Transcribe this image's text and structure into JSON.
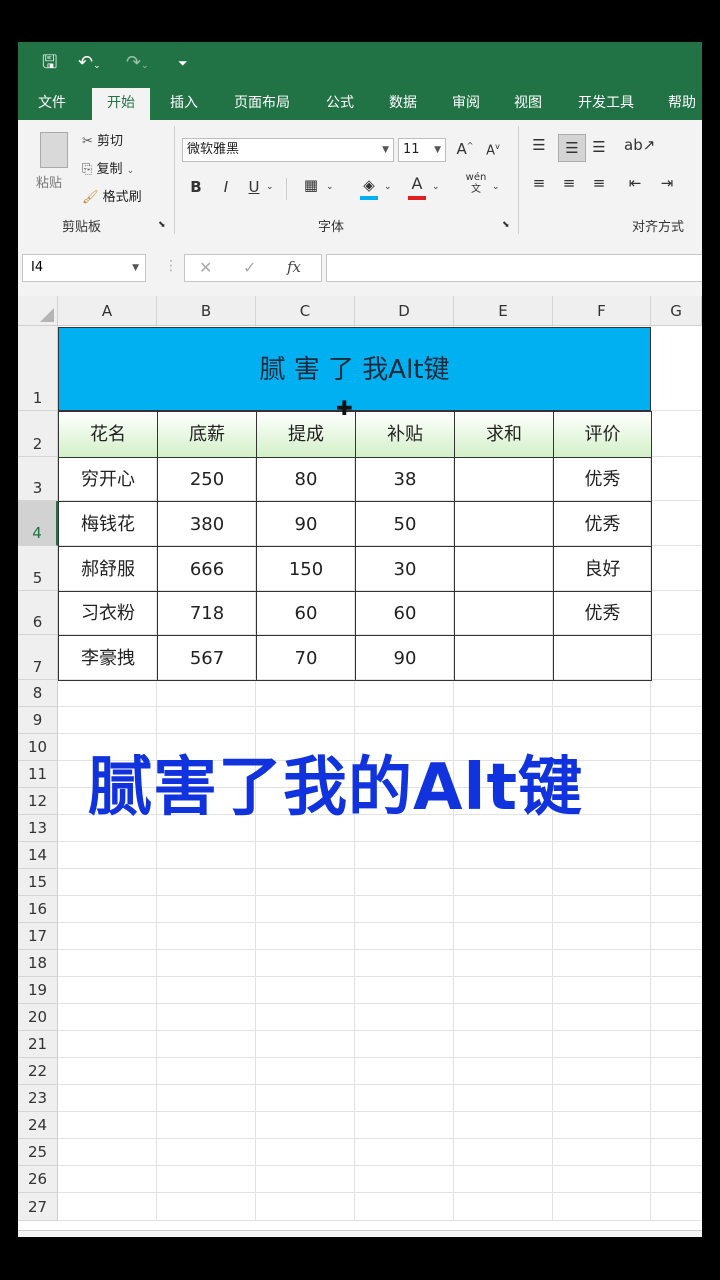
{
  "quick_access": {
    "save_icon": "save-icon",
    "undo_icon": "undo-icon",
    "redo_icon": "redo-icon",
    "customize_icon": "customize-icon"
  },
  "tabs": [
    "文件",
    "开始",
    "插入",
    "页面布局",
    "公式",
    "数据",
    "审阅",
    "视图",
    "开发工具",
    "帮助"
  ],
  "active_tab": "开始",
  "ribbon": {
    "clipboard": {
      "paste": "粘贴",
      "cut": "剪切",
      "copy": "复制",
      "format_painter": "格式刷",
      "group_label": "剪贴板"
    },
    "font": {
      "font_name": "微软雅黑",
      "font_size": "11",
      "bold": "B",
      "italic": "I",
      "underline": "U",
      "phonetic": "wén",
      "group_label": "字体"
    },
    "alignment": {
      "group_label": "对齐方式"
    }
  },
  "formula_bar": {
    "name_box": "I4",
    "cancel": "✕",
    "enter": "✓",
    "fx": "fx",
    "value": ""
  },
  "columns": [
    "A",
    "B",
    "C",
    "D",
    "E",
    "F",
    "G"
  ],
  "rows": [
    "1",
    "2",
    "3",
    "4",
    "5",
    "6",
    "7",
    "8",
    "9",
    "10",
    "11",
    "12",
    "13",
    "14",
    "15",
    "16",
    "17",
    "18",
    "19",
    "20",
    "21",
    "22",
    "23",
    "24",
    "25",
    "26",
    "27"
  ],
  "sheet": {
    "title": "腻 害 了 我Alt键",
    "headers": [
      "花名",
      "底薪",
      "提成",
      "补贴",
      "求和",
      "评价"
    ],
    "data": [
      [
        "穷开心",
        "250",
        "80",
        "38",
        "",
        "优秀"
      ],
      [
        "梅钱花",
        "380",
        "90",
        "50",
        "",
        "优秀"
      ],
      [
        "郝舒服",
        "666",
        "150",
        "30",
        "",
        "良好"
      ],
      [
        "习衣粉",
        "718",
        "60",
        "60",
        "",
        "优秀"
      ],
      [
        "李豪拽",
        "567",
        "70",
        "90",
        "",
        ""
      ]
    ]
  },
  "overlay_caption": "腻害了我的Alt键",
  "colors": {
    "excel_green": "#217346",
    "title_fill": "#00b0f0",
    "header_fill": "#e2efda",
    "overlay_text": "#1133dd"
  }
}
